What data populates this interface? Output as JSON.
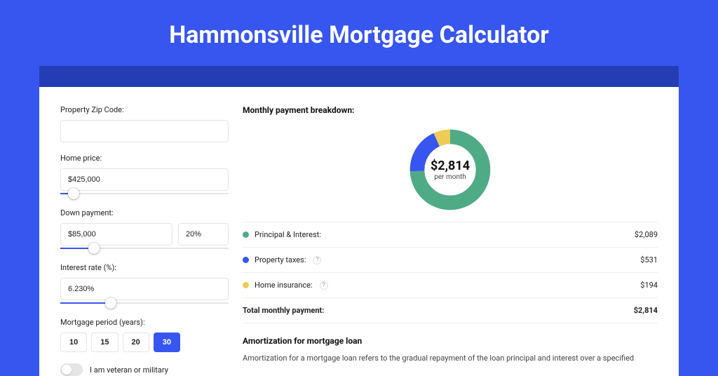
{
  "title": "Hammonsville Mortgage Calculator",
  "form": {
    "zip_label": "Property Zip Code:",
    "zip_value": "",
    "home_price_label": "Home price:",
    "home_price_value": "$425,000",
    "home_price_slider_pct": 8,
    "down_payment_label": "Down payment:",
    "down_payment_value": "$85,000",
    "down_payment_pct_value": "20%",
    "down_payment_slider_pct": 20,
    "interest_label": "Interest rate (%):",
    "interest_value": "6.230%",
    "interest_slider_pct": 30,
    "period_label": "Mortgage period (years):",
    "periods": [
      "10",
      "15",
      "20",
      "30"
    ],
    "period_selected": "30",
    "veteran_label": "I am veteran or military"
  },
  "breakdown": {
    "title": "Monthly payment breakdown:",
    "center_value": "$2,814",
    "center_sub": "per month",
    "items": [
      {
        "label": "Principal & Interest:",
        "value": "$2,089",
        "color": "#4fab85",
        "help": false
      },
      {
        "label": "Property taxes:",
        "value": "$531",
        "color": "#3756ef",
        "help": true
      },
      {
        "label": "Home insurance:",
        "value": "$194",
        "color": "#eecb54",
        "help": true
      }
    ],
    "total_label": "Total monthly payment:",
    "total_value": "$2,814"
  },
  "chart_data": {
    "type": "pie",
    "title": "Monthly payment breakdown",
    "series": [
      {
        "name": "Principal & Interest",
        "value": 2089,
        "color": "#4fab85"
      },
      {
        "name": "Property taxes",
        "value": 531,
        "color": "#3756ef"
      },
      {
        "name": "Home insurance",
        "value": 194,
        "color": "#eecb54"
      }
    ],
    "total": 2814,
    "center_label": "$2,814",
    "center_sub": "per month"
  },
  "amortization": {
    "title": "Amortization for mortgage loan",
    "text": "Amortization for a mortgage loan refers to the gradual repayment of the loan principal and interest over a specified"
  }
}
